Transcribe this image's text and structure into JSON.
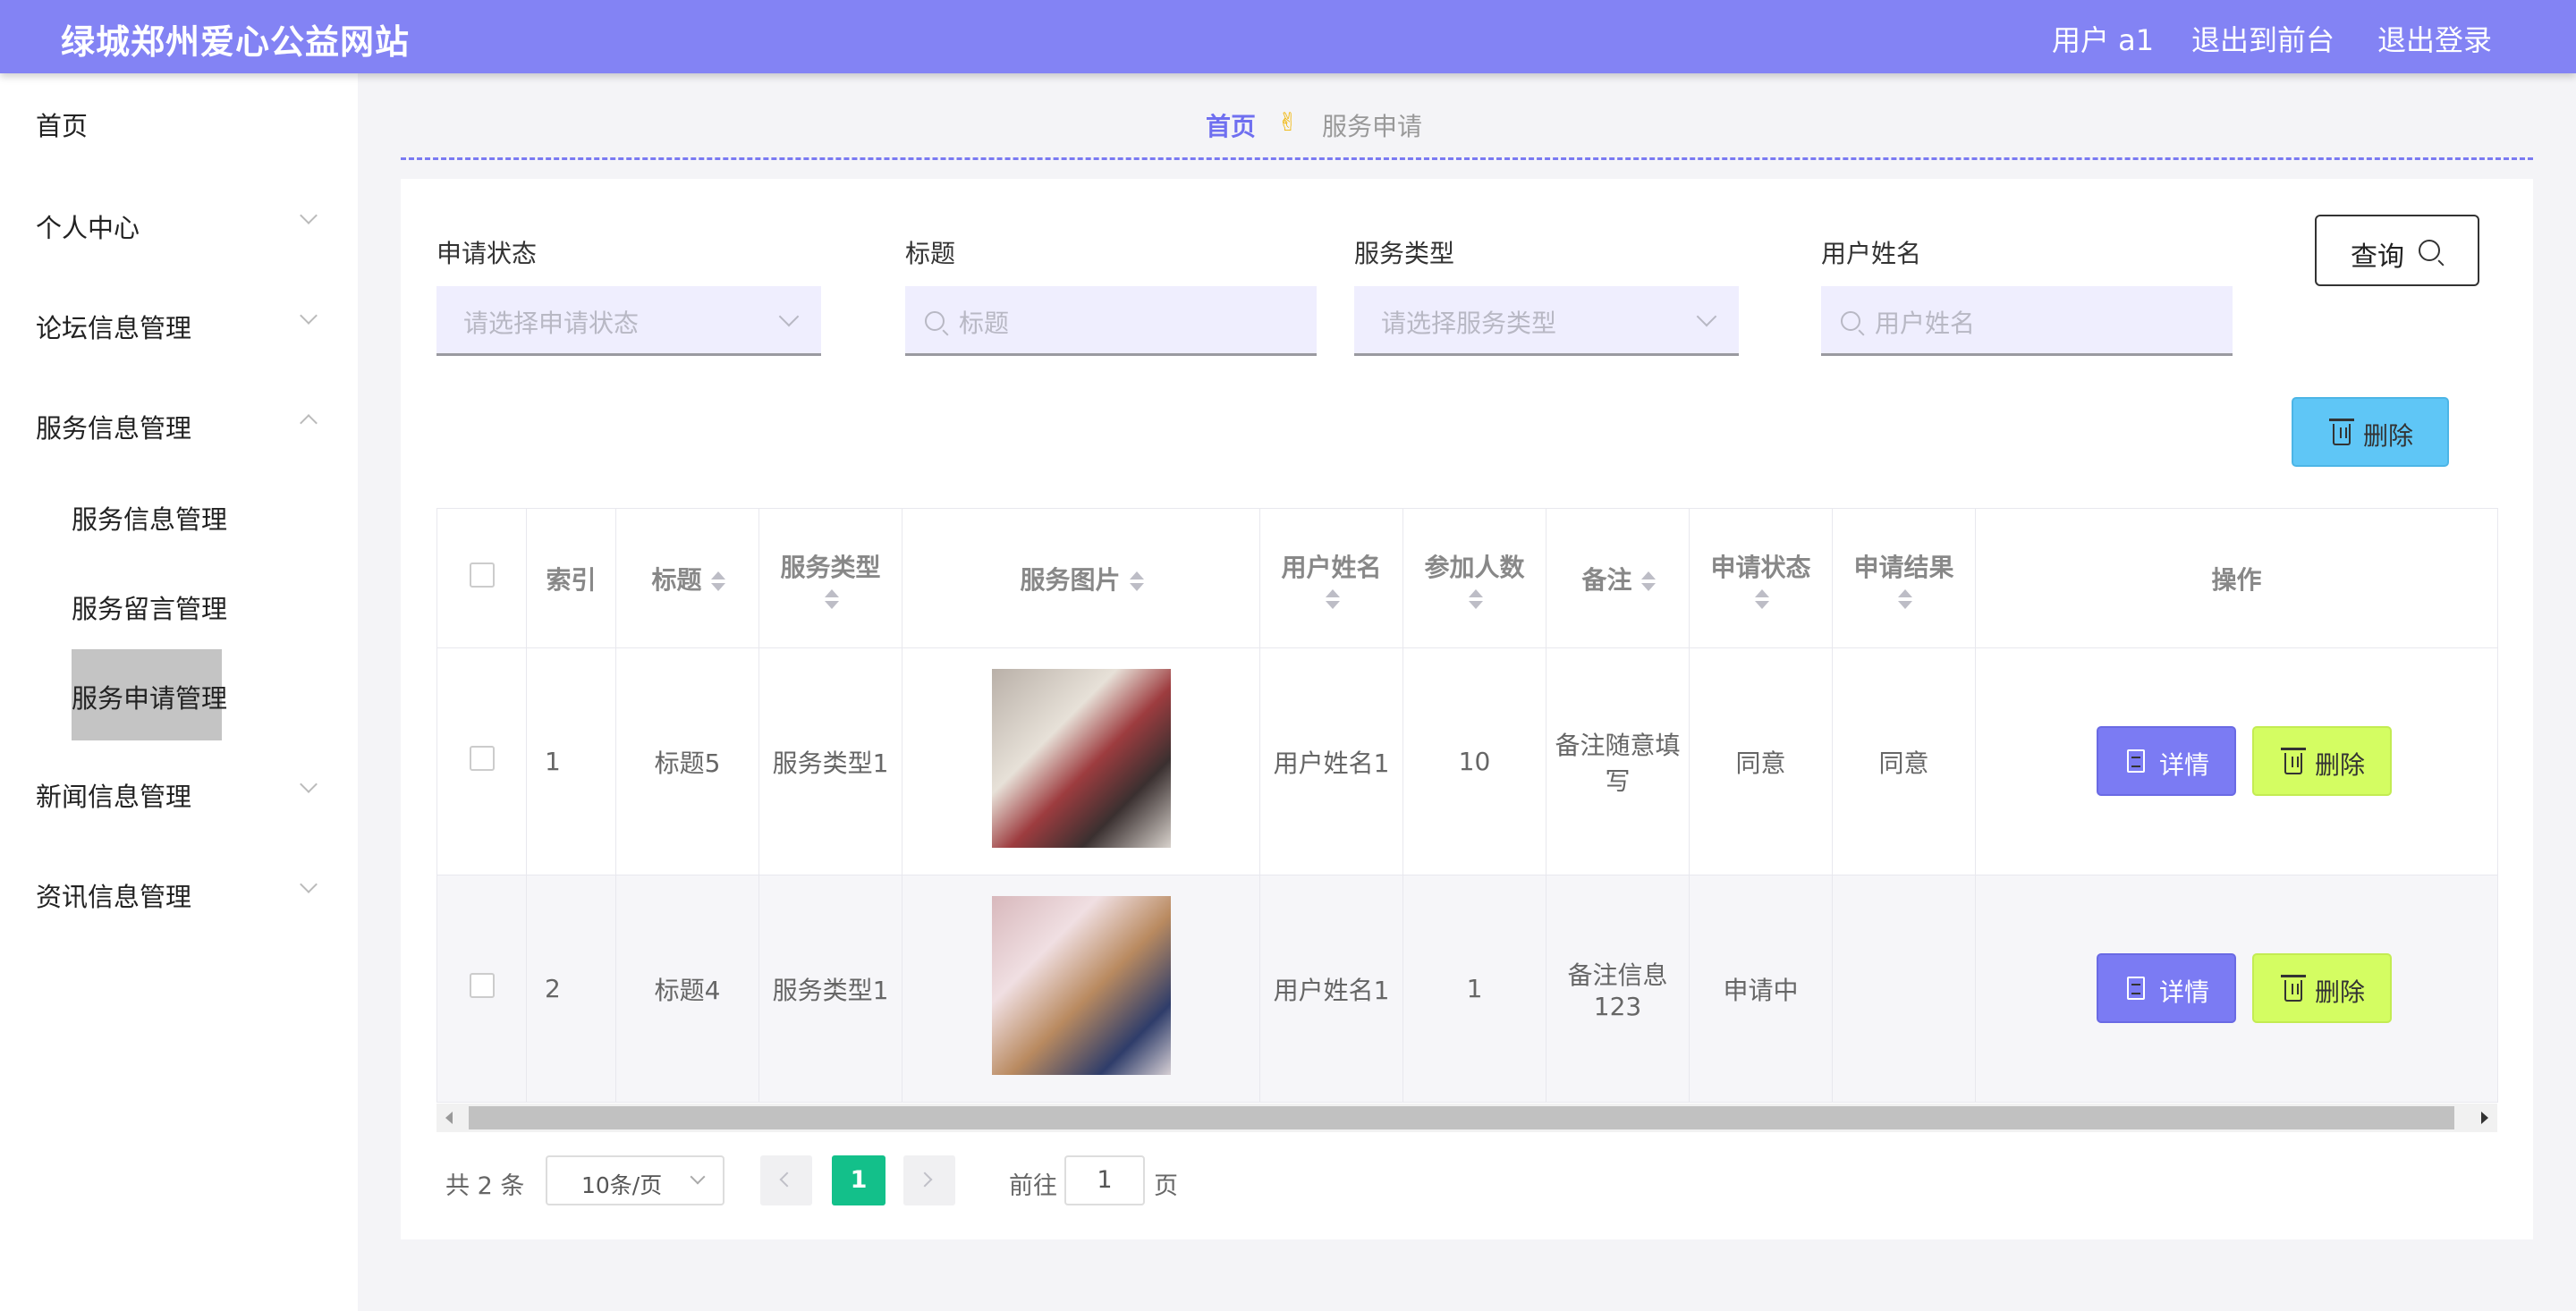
{
  "header": {
    "brand": "绿城郑州爱心公益网站",
    "user": "用户 a1",
    "to_front": "退出到前台",
    "logout": "退出登录",
    "bg_color": "#8383f4"
  },
  "sidebar": {
    "items": [
      {
        "label": "首页"
      },
      {
        "label": "个人中心"
      },
      {
        "label": "论坛信息管理"
      },
      {
        "label": "服务信息管理"
      },
      {
        "label": "新闻信息管理"
      },
      {
        "label": "资讯信息管理"
      }
    ],
    "sub_items": [
      {
        "label": "服务信息管理"
      },
      {
        "label": "服务留言管理"
      },
      {
        "label": "服务申请管理"
      }
    ]
  },
  "breadcrumb": {
    "home": "首页",
    "separator_icon": "✌",
    "current": "服务申请"
  },
  "filters": {
    "status_label": "申请状态",
    "status_placeholder": "请选择申请状态",
    "title_label": "标题",
    "title_placeholder": "标题",
    "type_label": "服务类型",
    "type_placeholder": "请选择服务类型",
    "username_label": "用户姓名",
    "username_placeholder": "用户姓名",
    "query_button": "查询"
  },
  "toolbar": {
    "delete_button": "删除",
    "delete_color": "#5fc6f6"
  },
  "table": {
    "headers": [
      "索引",
      "标题",
      "服务类型",
      "服务图片",
      "用户姓名",
      "参加人数",
      "备注",
      "申请状态",
      "申请结果",
      "操作"
    ],
    "rows": [
      {
        "index": "1",
        "title": "标题5",
        "type": "服务类型1",
        "username": "用户姓名1",
        "count": "10",
        "note": "备注随意填写",
        "status": "同意",
        "result": "同意"
      },
      {
        "index": "2",
        "title": "标题4",
        "type": "服务类型1",
        "username": "用户姓名1",
        "count": "1",
        "note": "备注信息123",
        "status": "申请中",
        "result": ""
      }
    ],
    "detail_button": "详情",
    "delete_button": "删除",
    "detail_color": "#7b7bf3",
    "delete_color": "#d4fd62"
  },
  "pagination": {
    "total": "共 2 条",
    "page_size": "10条/页",
    "current_page": "1",
    "goto_label": "前往",
    "goto_value": "1",
    "page_unit": "页",
    "active_color": "#13c08a"
  }
}
